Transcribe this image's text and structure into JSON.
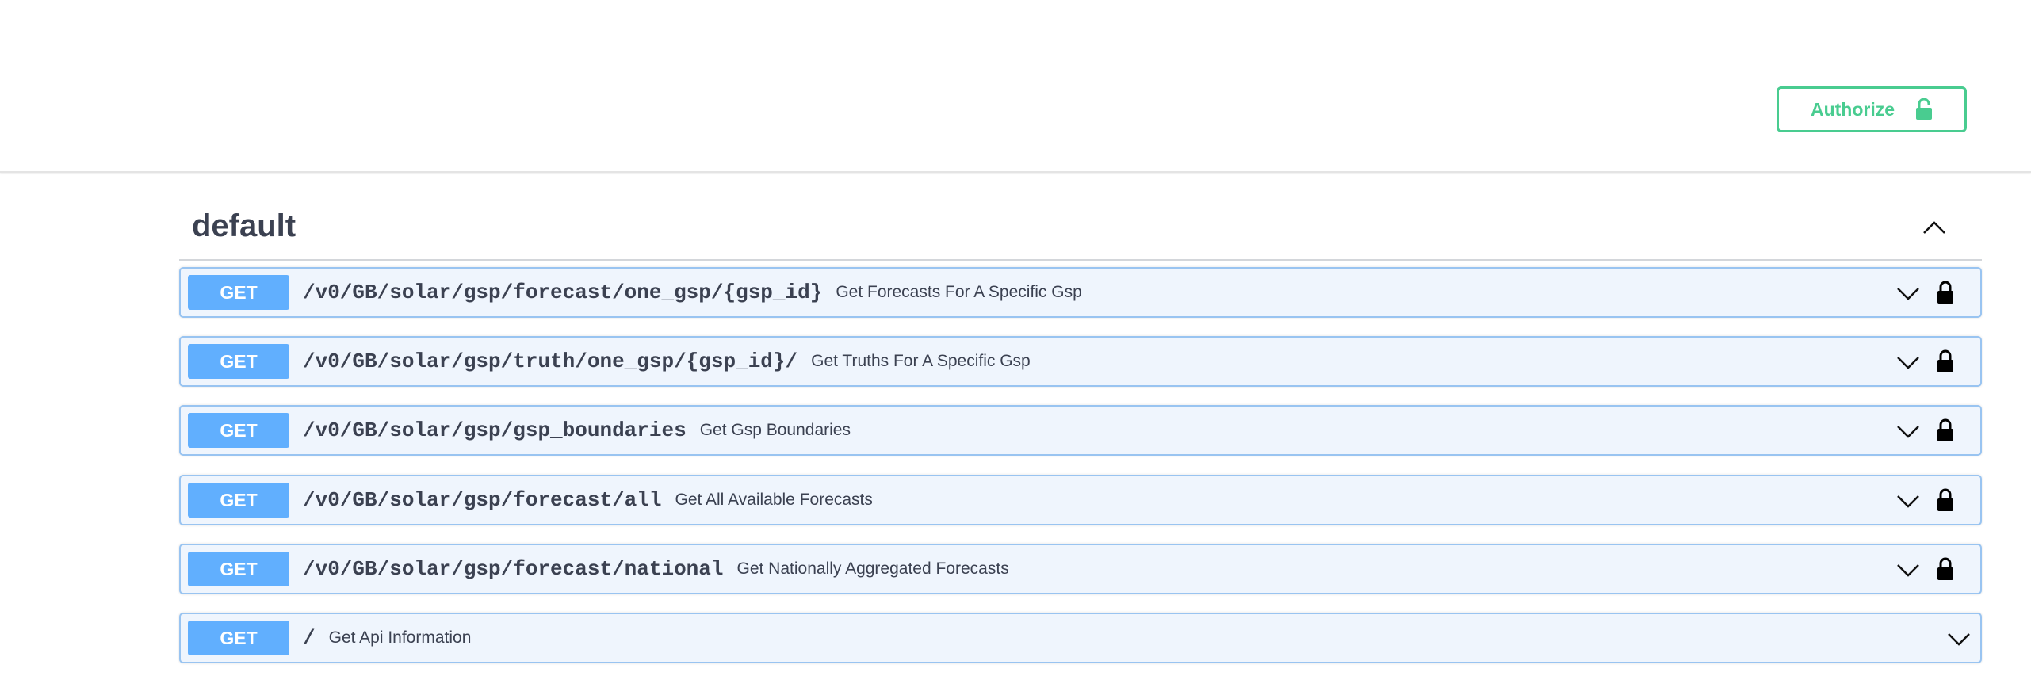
{
  "auth": {
    "authorize_label": "Authorize"
  },
  "section": {
    "title": "default"
  },
  "operations": [
    {
      "method": "GET",
      "path": "/v0/GB/solar/gsp/forecast/one_gsp/{gsp_id}",
      "summary": "Get Forecasts For A Specific Gsp",
      "locked": true
    },
    {
      "method": "GET",
      "path": "/v0/GB/solar/gsp/truth/one_gsp/{gsp_id}/",
      "summary": "Get Truths For A Specific Gsp",
      "locked": true
    },
    {
      "method": "GET",
      "path": "/v0/GB/solar/gsp/gsp_boundaries",
      "summary": "Get Gsp Boundaries",
      "locked": true
    },
    {
      "method": "GET",
      "path": "/v0/GB/solar/gsp/forecast/all",
      "summary": "Get All Available Forecasts",
      "locked": true
    },
    {
      "method": "GET",
      "path": "/v0/GB/solar/gsp/forecast/national",
      "summary": "Get Nationally Aggregated Forecasts",
      "locked": true
    },
    {
      "method": "GET",
      "path": "/",
      "summary": "Get Api Information",
      "locked": false
    }
  ],
  "colors": {
    "get_method": "#61affe",
    "get_border": "#99c4f1",
    "get_background": "#eff5fd",
    "authorize_accent": "#49cc90",
    "text": "#3b4151"
  },
  "icons": {
    "authorize": "unlocked-padlock-icon",
    "collapse": "chevron-up-icon",
    "expand": "chevron-down-icon",
    "secured": "lock-icon"
  }
}
